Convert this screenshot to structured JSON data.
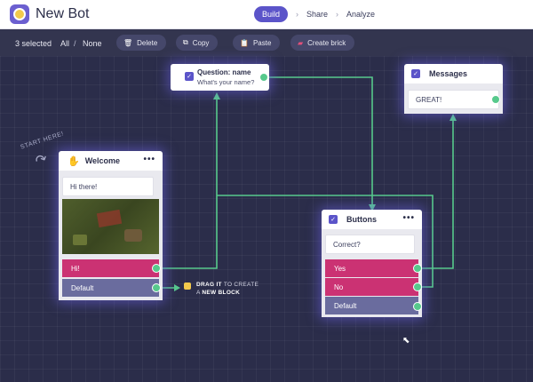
{
  "header": {
    "bot_name": "New Bot",
    "nav": [
      {
        "label": "Build",
        "active": true
      },
      {
        "label": "Share"
      },
      {
        "label": "Analyze"
      }
    ],
    "nav_separator": "›"
  },
  "toolbar": {
    "selected_count": "3 selected",
    "select_all": "All",
    "separator": "/",
    "select_none": "None",
    "buttons": [
      {
        "label": "Delete",
        "icon": "trash-icon"
      },
      {
        "label": "Copy",
        "icon": "copy-icon"
      },
      {
        "label": "Paste",
        "icon": "clipboard-icon"
      },
      {
        "label": "Create brick",
        "icon": "brick-icon"
      }
    ]
  },
  "canvas": {
    "start_hint": "START HERE!",
    "drag_hint": {
      "bold1": "DRAG IT",
      "rest1": " TO CREATE",
      "rest2": "A ",
      "bold2": "NEW BLOCK"
    }
  },
  "blocks": {
    "welcome": {
      "title": "Welcome",
      "message": "Hi there!",
      "image": "gif-thumbnail-army",
      "answers": [
        "Hi!",
        "Default"
      ]
    },
    "question": {
      "title": "Question: name",
      "subtitle": "What's your name?"
    },
    "messages": {
      "title": "Messages",
      "message": "GREAT!"
    },
    "buttons": {
      "title": "Buttons",
      "message": "Correct?",
      "answers": [
        "Yes",
        "No",
        "Default"
      ]
    }
  },
  "colors": {
    "accent": "#5b54c9",
    "wire": "#57c98c",
    "answer_pink": "#cb3273",
    "answer_slate": "#6a6c9e",
    "canvas": "#2b2d4a"
  }
}
